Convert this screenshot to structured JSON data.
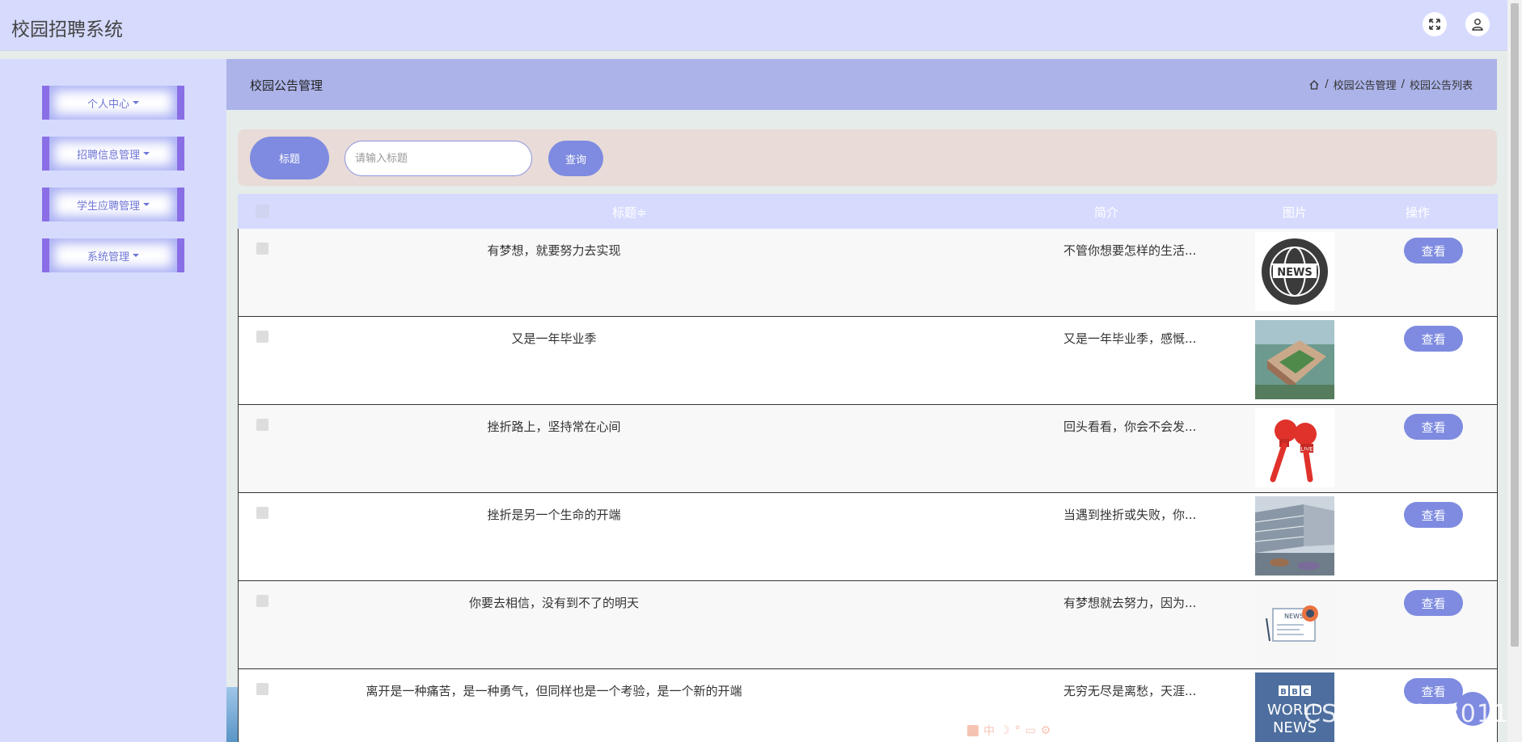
{
  "header": {
    "app_title": "校园招聘系统"
  },
  "sidebar": {
    "items": [
      {
        "label": "个人中心"
      },
      {
        "label": "招聘信息管理"
      },
      {
        "label": "学生应聘管理"
      },
      {
        "label": "系统管理"
      }
    ]
  },
  "crumb_bar": {
    "title": "校园公告管理",
    "breadcrumbs": [
      "校园公告管理",
      "校园公告列表"
    ],
    "separator": "/"
  },
  "search": {
    "label": "标题",
    "placeholder": "请输入标题",
    "query_button": "查询"
  },
  "table": {
    "columns": [
      "标题",
      "简介",
      "图片",
      "操作"
    ],
    "sort_indicator": "≑",
    "rows": [
      {
        "title": "有梦想，就要努力去实现",
        "intro": "不管你想要怎样的生活...",
        "image": "news-globe-icon",
        "action": "查看"
      },
      {
        "title": "又是一年毕业季",
        "intro": "又是一年毕业季，感慨...",
        "image": "campus-aerial-photo",
        "action": "查看"
      },
      {
        "title": "挫折路上，坚持常在心间",
        "intro": "回头看看，你会不会发...",
        "image": "live-microphone-icon",
        "action": "查看"
      },
      {
        "title": "挫折是另一个生命的开端",
        "intro": "当遇到挫折或失败，你...",
        "image": "campus-building-photo",
        "action": "查看"
      },
      {
        "title": "你要去相信，没有到不了的明天",
        "intro": "有梦想就去努力，因为...",
        "image": "newspaper-icon",
        "action": "查看"
      },
      {
        "title": "离开是一种痛苦，是一种勇气，但同样也是一个考验，是一个新的开端",
        "intro": "无穷无尽是离愁，天涯...",
        "image": "bbc-world-news-logo",
        "action": "查看"
      }
    ]
  },
  "overlay": {
    "watermark": "CSDN @CK3011",
    "ime_text": "中"
  },
  "colors": {
    "header_bg": "#d6dbfe",
    "accent": "#7e8be0",
    "crumb_bg": "#abb3e9",
    "search_bg": "#e8dbd8",
    "menu_border": "#8a6ee6"
  }
}
